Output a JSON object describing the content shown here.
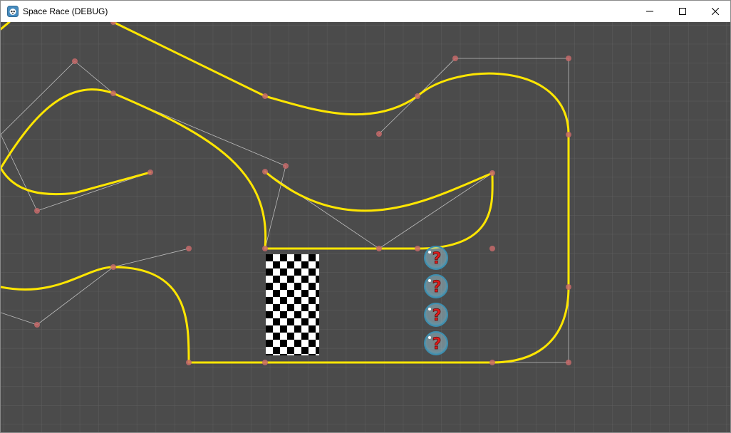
{
  "window": {
    "title": "Space Race (DEBUG)",
    "app_icon": "godot-engine-icon",
    "controls": [
      "minimize-icon",
      "maximize-icon",
      "close-icon"
    ]
  },
  "scene": {
    "background_color": "#4b4b4b",
    "grid_color": "#5e5e5e",
    "track_color": "#ffe600",
    "control_point_color": "#c56a6a",
    "guide_line_color": "#bdbdbd",
    "finish_line": "checkered-flag",
    "mystery_boxes": [
      {
        "icon": "question-mark-bubble-icon"
      },
      {
        "icon": "question-mark-bubble-icon"
      },
      {
        "icon": "question-mark-bubble-icon"
      },
      {
        "icon": "question-mark-bubble-icon"
      }
    ]
  }
}
